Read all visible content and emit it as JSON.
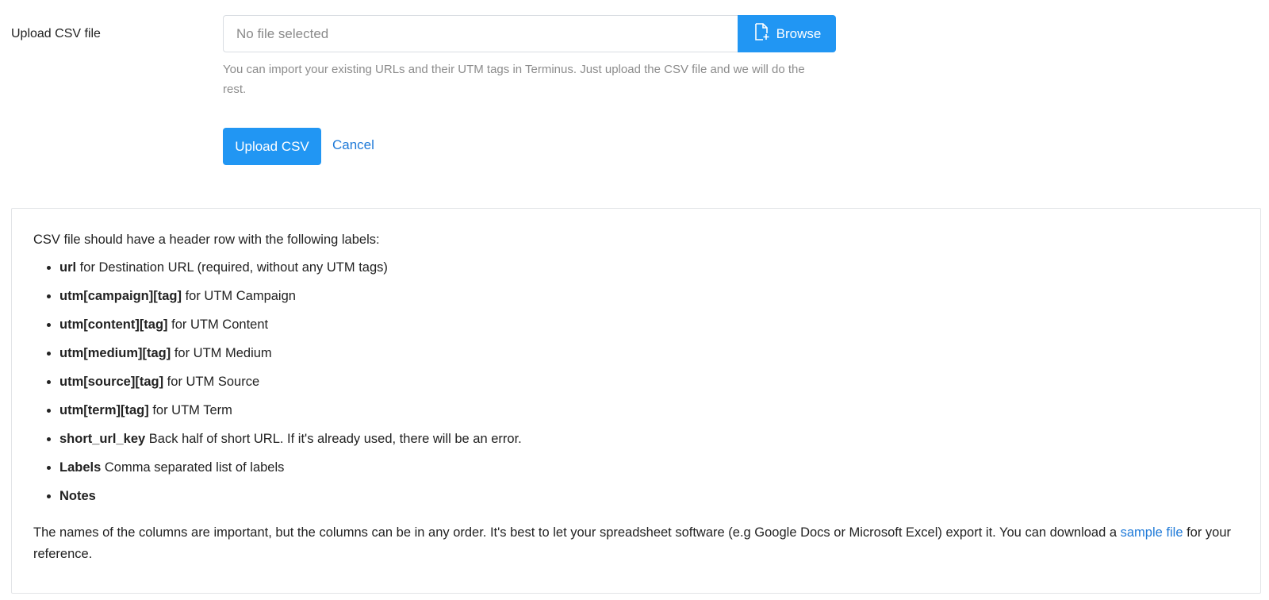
{
  "upload": {
    "label": "Upload CSV file",
    "file_placeholder": "No file selected",
    "browse_label": "Browse",
    "help_text": "You can import your existing URLs and their UTM tags in Terminus. Just upload the CSV file and we will do the rest.",
    "submit_label": "Upload CSV",
    "cancel_label": "Cancel"
  },
  "info": {
    "intro": "CSV file should have a header row with the following labels:",
    "items": [
      {
        "key": "url",
        "desc": " for Destination URL (required, without any UTM tags)"
      },
      {
        "key": "utm[campaign][tag]",
        "desc": " for UTM Campaign"
      },
      {
        "key": "utm[content][tag]",
        "desc": " for UTM Content"
      },
      {
        "key": "utm[medium][tag]",
        "desc": " for UTM Medium"
      },
      {
        "key": "utm[source][tag]",
        "desc": " for UTM Source"
      },
      {
        "key": "utm[term][tag]",
        "desc": " for UTM Term"
      },
      {
        "key": "short_url_key",
        "desc": " Back half of short URL. If it's already used, there will be an error."
      },
      {
        "key": "Labels",
        "desc": " Comma separated list of labels"
      },
      {
        "key": "Notes",
        "desc": ""
      }
    ],
    "outro_before": "The names of the columns are important, but the columns can be in any order. It's best to let your spreadsheet software (e.g Google Docs or Microsoft Excel) export it. You can download a ",
    "sample_link": "sample file",
    "outro_after": " for your reference."
  },
  "icons": {
    "browse": "file-add-icon"
  },
  "colors": {
    "primary": "#2196f3",
    "link": "#1f7ad8",
    "help_text": "#8c8c8c"
  }
}
